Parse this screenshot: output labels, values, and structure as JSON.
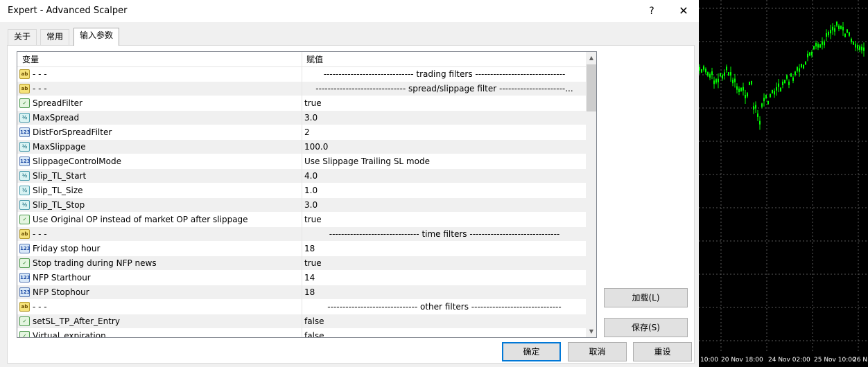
{
  "window": {
    "title": "Expert - Advanced Scalper",
    "help_label": "?",
    "close_label": "✕"
  },
  "tabs": [
    {
      "label": "关于",
      "active": false
    },
    {
      "label": "常用",
      "active": false
    },
    {
      "label": "输入参数",
      "active": true
    }
  ],
  "grid": {
    "col_variable": "变量",
    "col_value": "赋值",
    "rows": [
      {
        "icon": "ab-icon",
        "name": "- - -",
        "value": "------------------------------ trading filters ------------------------------",
        "sep": true
      },
      {
        "icon": "ab-icon",
        "name": "- - -",
        "value": "------------------------------ spread/slippage filter ----------------------...",
        "sep": true
      },
      {
        "icon": "bool-icon",
        "name": "SpreadFilter",
        "value": "true",
        "sep": false
      },
      {
        "icon": "fraction-icon",
        "name": "MaxSpread",
        "value": "3.0",
        "sep": false
      },
      {
        "icon": "number-123-icon",
        "name": "DistForSpreadFilter",
        "value": "2",
        "sep": false
      },
      {
        "icon": "fraction-icon",
        "name": "MaxSlippage",
        "value": "100.0",
        "sep": false
      },
      {
        "icon": "number-123-icon",
        "name": "SlippageControlMode",
        "value": "Use Slippage Trailing SL mode",
        "sep": false
      },
      {
        "icon": "fraction-icon",
        "name": "Slip_TL_Start",
        "value": "4.0",
        "sep": false
      },
      {
        "icon": "fraction-icon",
        "name": "Slip_TL_Size",
        "value": "1.0",
        "sep": false
      },
      {
        "icon": "fraction-icon",
        "name": "Slip_TL_Stop",
        "value": "3.0",
        "sep": false
      },
      {
        "icon": "bool-icon",
        "name": "Use Original OP instead of market OP after slippage",
        "value": "true",
        "sep": false
      },
      {
        "icon": "ab-icon",
        "name": "- - -",
        "value": "------------------------------ time filters ------------------------------",
        "sep": true
      },
      {
        "icon": "number-123-icon",
        "name": "Friday stop hour",
        "value": "18",
        "sep": false
      },
      {
        "icon": "bool-icon",
        "name": "Stop trading during NFP news",
        "value": "true",
        "sep": false
      },
      {
        "icon": "number-123-icon",
        "name": "NFP Starthour",
        "value": "14",
        "sep": false
      },
      {
        "icon": "number-123-icon",
        "name": "NFP Stophour",
        "value": "18",
        "sep": false
      },
      {
        "icon": "ab-icon",
        "name": "- - -",
        "value": "------------------------------ other filters ------------------------------",
        "sep": true
      },
      {
        "icon": "bool-icon",
        "name": "setSL_TP_After_Entry",
        "value": "false",
        "sep": false
      },
      {
        "icon": "bool-icon",
        "name": "Virtual_expiration",
        "value": "false",
        "sep": false
      }
    ]
  },
  "buttons": {
    "load": "加载(L)",
    "save": "保存(S)",
    "ok": "确定",
    "cancel": "取消",
    "reset": "重设"
  },
  "chart_axis": {
    "labels": [
      "10:00",
      "20 Nov 18:00",
      "24 Nov 02:00",
      "25 Nov 10:00",
      "26 N"
    ]
  },
  "colors": {
    "candle": "#00ff00",
    "grid": "#5a5a5a",
    "default_button_border": "#0078d7"
  }
}
